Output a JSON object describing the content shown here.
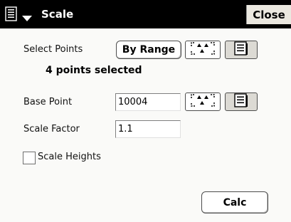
{
  "title_bar": {
    "title": "Scale",
    "close_label": "Close",
    "menu_icon": "document-menu-icon",
    "chevron_icon": "chevron-down-icon"
  },
  "select_points": {
    "label": "Select Points",
    "by_range_label": "By Range",
    "map_icon": "map-select-icon",
    "list_icon": "list-select-icon"
  },
  "status_text": "4 points selected",
  "base_point": {
    "label": "Base Point",
    "value": "10004",
    "map_icon": "map-select-icon",
    "list_icon": "list-select-icon"
  },
  "scale_factor": {
    "label": "Scale Factor",
    "value": "1.1"
  },
  "scale_heights": {
    "label": "Scale Heights",
    "checked": false
  },
  "calc_label": "Calc",
  "colors": {
    "title_bar_bg": "#000000",
    "title_text": "#ffffff",
    "close_bg": "#ebe8e0",
    "window_bg": "#fafaf8"
  }
}
